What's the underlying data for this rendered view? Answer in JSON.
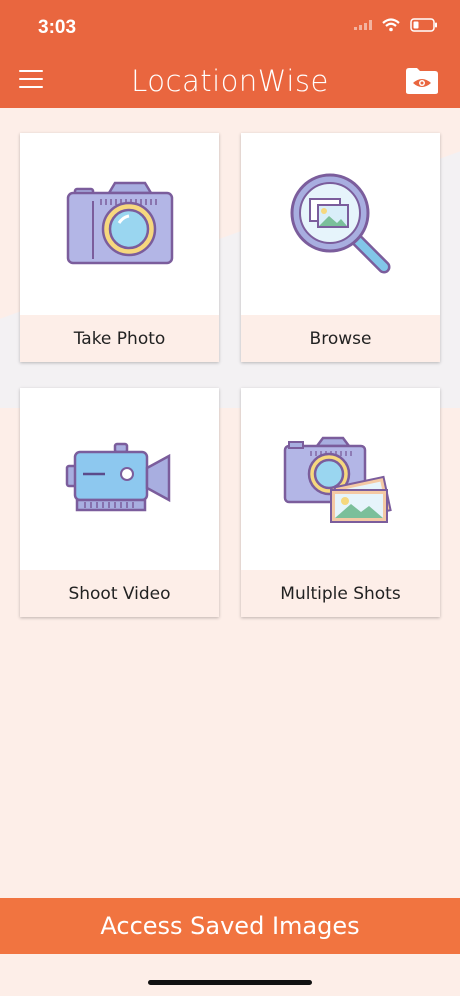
{
  "status": {
    "time": "3:03"
  },
  "app": {
    "title": "LocationWise"
  },
  "icons": {
    "menu": "menu-icon",
    "folder": "folder-eye-icon",
    "take_photo": "camera-icon",
    "browse": "magnifier-photo-icon",
    "shoot_video": "video-camera-icon",
    "multiple_shots": "camera-photos-icon"
  },
  "tiles": [
    {
      "label": "Take Photo"
    },
    {
      "label": "Browse"
    },
    {
      "label": "Shoot Video"
    },
    {
      "label": "Multiple Shots"
    }
  ],
  "footer": {
    "label": "Access Saved Images"
  },
  "colors": {
    "accent": "#e9663f",
    "footer": "#f17440",
    "background": "#fdeee8"
  }
}
